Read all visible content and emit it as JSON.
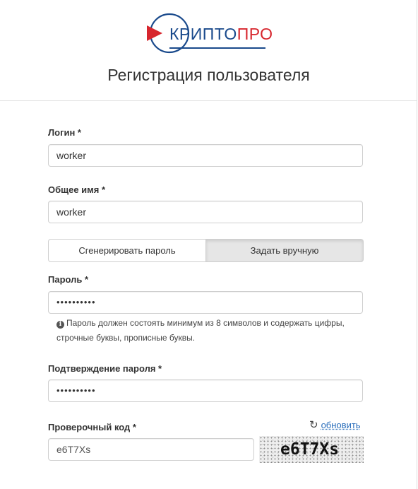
{
  "header": {
    "logo_text_primary": "КРИПТО",
    "logo_text_accent": "ПРО",
    "title": "Регистрация пользователя"
  },
  "form": {
    "login": {
      "label": "Логин *",
      "value": "worker"
    },
    "common_name": {
      "label": "Общее имя *",
      "value": "worker"
    },
    "password_mode": {
      "options": [
        "Сгенерировать пароль",
        "Задать вручную"
      ],
      "selected": "Задать вручную"
    },
    "password": {
      "label": "Пароль *",
      "value": "••••••••••",
      "hint": "Пароль должен состоять минимум из 8 символов и содержать цифры, строчные буквы, прописные буквы."
    },
    "password_confirm": {
      "label": "Подтверждение пароля *",
      "value": "••••••••••"
    },
    "captcha": {
      "label": "Проверочный код *",
      "value": "e6T7Xs",
      "refresh_label": "обновить",
      "image_text": "e6T7Xs"
    }
  },
  "colors": {
    "brand_blue": "#1a4a8c",
    "brand_red": "#d7262e",
    "link": "#2a6ebb"
  }
}
